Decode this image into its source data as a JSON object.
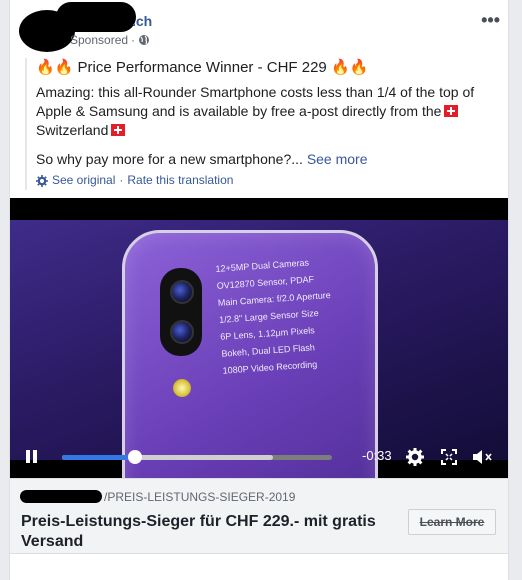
{
  "header": {
    "page_name": ".ch",
    "sponsored_label": "Sponsored",
    "separator": "·",
    "more_label": "•••"
  },
  "post": {
    "headline_prefix": "🔥🔥",
    "headline": "Price Performance Winner - CHF 229",
    "headline_suffix": "🔥🔥",
    "body_line1": "Amazing: this all-Rounder Smartphone costs less than 1/4 of the top of Apple & Samsung and is available by free a-post directly from the",
    "body_line2": "Switzerland",
    "question": "So why pay more for a new smartphone?...",
    "see_more": "See more",
    "see_original": "See original",
    "dot": "·",
    "rate_translation": "Rate this translation"
  },
  "video": {
    "specs": [
      "12+5MP Dual Cameras",
      "OV12870 Sensor, PDAF",
      "Main Camera: f/2.0 Aperture",
      "1/2.8\" Large Sensor Size",
      "6P Lens, 1.12μm Pixels",
      "Bokeh, Dual LED Flash",
      "1080P Video Recording"
    ],
    "time_remaining": "-0:33",
    "played_fraction": 0.27,
    "buffered_fraction": 0.78
  },
  "link": {
    "domain_path": "/PREIS-LEISTUNGS-SIEGER-2019",
    "title": "Preis-Leistungs-Sieger für CHF 229.- mit gratis Versand",
    "cta_label": "Learn More"
  },
  "colors": {
    "link_blue": "#385898",
    "progress_blue": "#3578e5",
    "flag_red": "#e41e26"
  },
  "icons": [
    "globe-icon",
    "gear-icon",
    "pause-icon",
    "settings-icon",
    "fullscreen-icon",
    "volume-muted-icon",
    "flag-icon",
    "fire-icon"
  ]
}
